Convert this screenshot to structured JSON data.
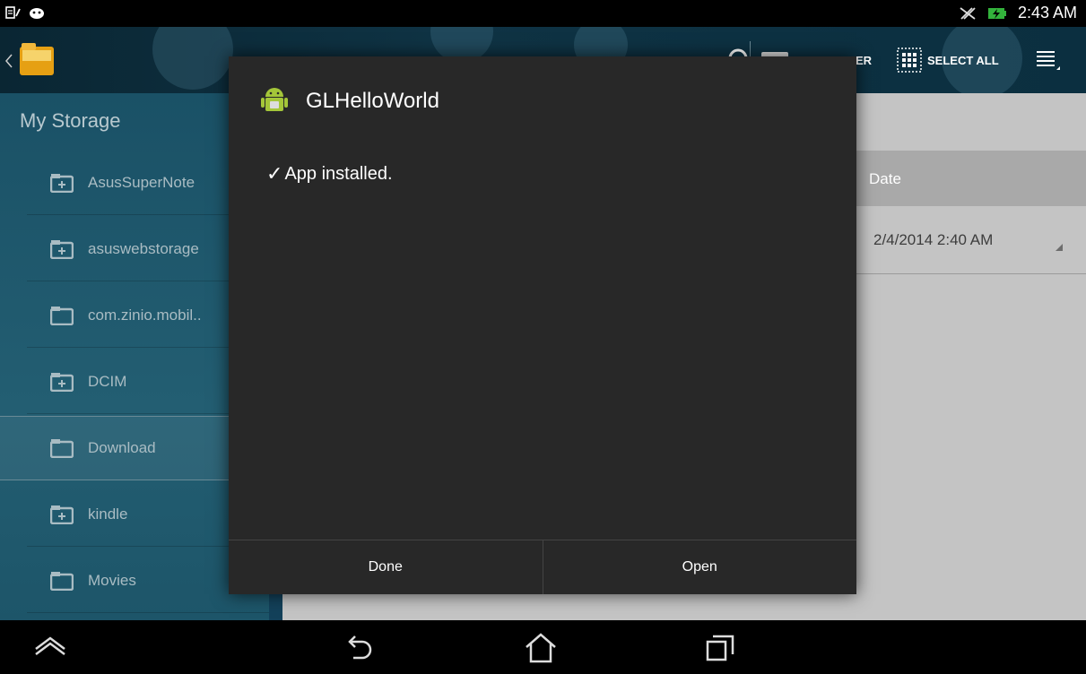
{
  "status_bar": {
    "time": "2:43 AM",
    "left_icons": [
      "notification-icon",
      "android-debug-icon"
    ],
    "right_icons": [
      "no-sync-icon",
      "battery-charging-icon"
    ],
    "battery_color": "#33b33c"
  },
  "action_bar": {
    "partial_label": "ER",
    "select_all_label": "SELECT ALL",
    "icons": [
      "folder-app-icon",
      "search-icon",
      "new-folder-icon",
      "select-all-icon",
      "overflow-menu-icon"
    ]
  },
  "sidebar": {
    "title": "My Storage",
    "items": [
      {
        "label": "AsusSuperNote",
        "icon": "folder-plus-icon"
      },
      {
        "label": "asuswebstorage",
        "icon": "folder-plus-icon"
      },
      {
        "label": "com.zinio.mobil..",
        "icon": "folder-icon"
      },
      {
        "label": "DCIM",
        "icon": "folder-plus-icon"
      },
      {
        "label": "Download",
        "icon": "folder-icon"
      },
      {
        "label": "kindle",
        "icon": "folder-plus-icon"
      },
      {
        "label": "Movies",
        "icon": "folder-icon"
      }
    ],
    "selected": "Download"
  },
  "file_list": {
    "column_header_date": "Date",
    "rows": [
      {
        "date": "2/4/2014 2:40 AM"
      }
    ]
  },
  "dialog": {
    "title": "GLHelloWorld",
    "message": "App installed.",
    "done_label": "Done",
    "open_label": "Open",
    "icon": "android-app-icon"
  },
  "nav_bar": {
    "icons": [
      "recent-apps-up-icon",
      "back-icon",
      "home-icon",
      "recents-icon"
    ]
  }
}
